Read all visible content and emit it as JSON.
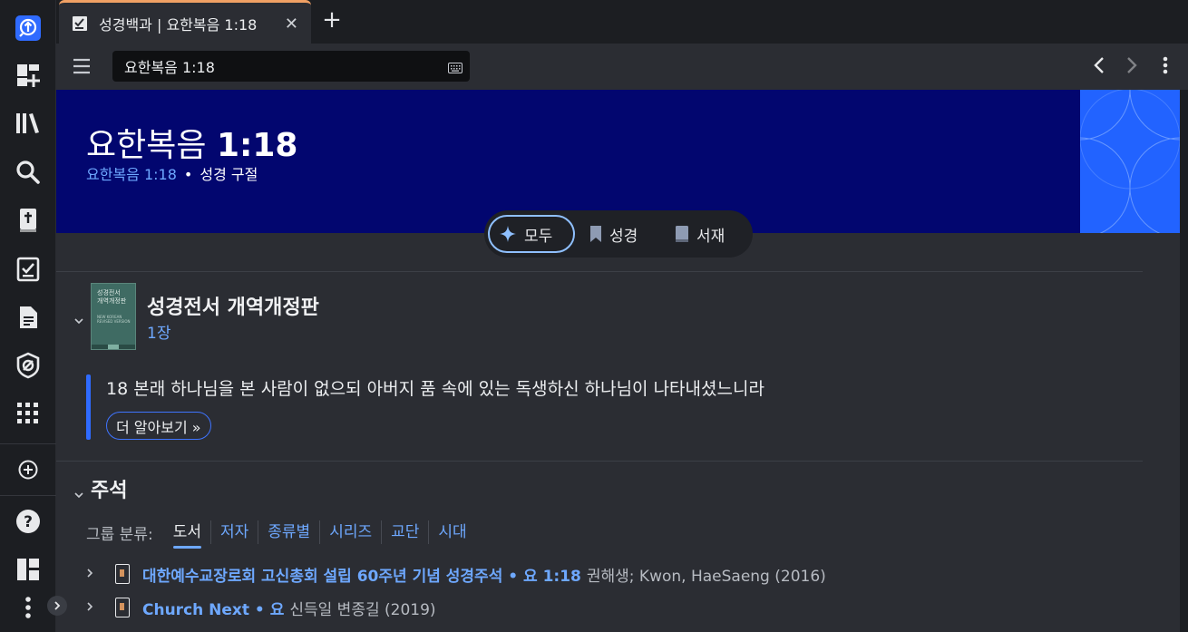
{
  "tab": {
    "title": "성경백과 | 요한복음 1:18",
    "close": "✕",
    "new": "+"
  },
  "toolbar": {
    "address_value": "요한복음 1:18"
  },
  "header": {
    "title_prefix": "요한복음 ",
    "title_ref": "1:18",
    "sub_link": "요한복음 1:18",
    "sub_dot": "•",
    "sub_type": "성경 구절"
  },
  "filters": {
    "all": "모두",
    "bible": "성경",
    "library": "서재"
  },
  "bible": {
    "cover_line1": "성경전서",
    "cover_line2": "개역개정판",
    "cover_line3": "NEW KOREAN REVISED VERSION",
    "title": "성경전서 개역개정판",
    "chapter": "1장",
    "verse": "18 본래 하나님을 본 사람이 없으되 아버지 품 속에 있는 독생하신 하나님이 나타내셨느니라",
    "more": "더 알아보기 »"
  },
  "commentary": {
    "title": "주석",
    "group_label": "그룹 분류:",
    "groups": [
      "도서",
      "저자",
      "종류별",
      "시리즈",
      "교단",
      "시대"
    ],
    "active_group": "도서",
    "resources": [
      {
        "title": "대한예수교장로회 고신총회 설립 60주년 기념 성경주석 • 요 1:18",
        "meta": "권해생; Kwon, HaeSaeng (2016)"
      },
      {
        "title": "Church Next • 요",
        "meta": "신득일 변종길 (2019)"
      }
    ]
  },
  "colors": {
    "banner": "#02066f",
    "accent": "#6ea8ff",
    "tab_accent": "#f0a064",
    "art": "#2263ff"
  }
}
